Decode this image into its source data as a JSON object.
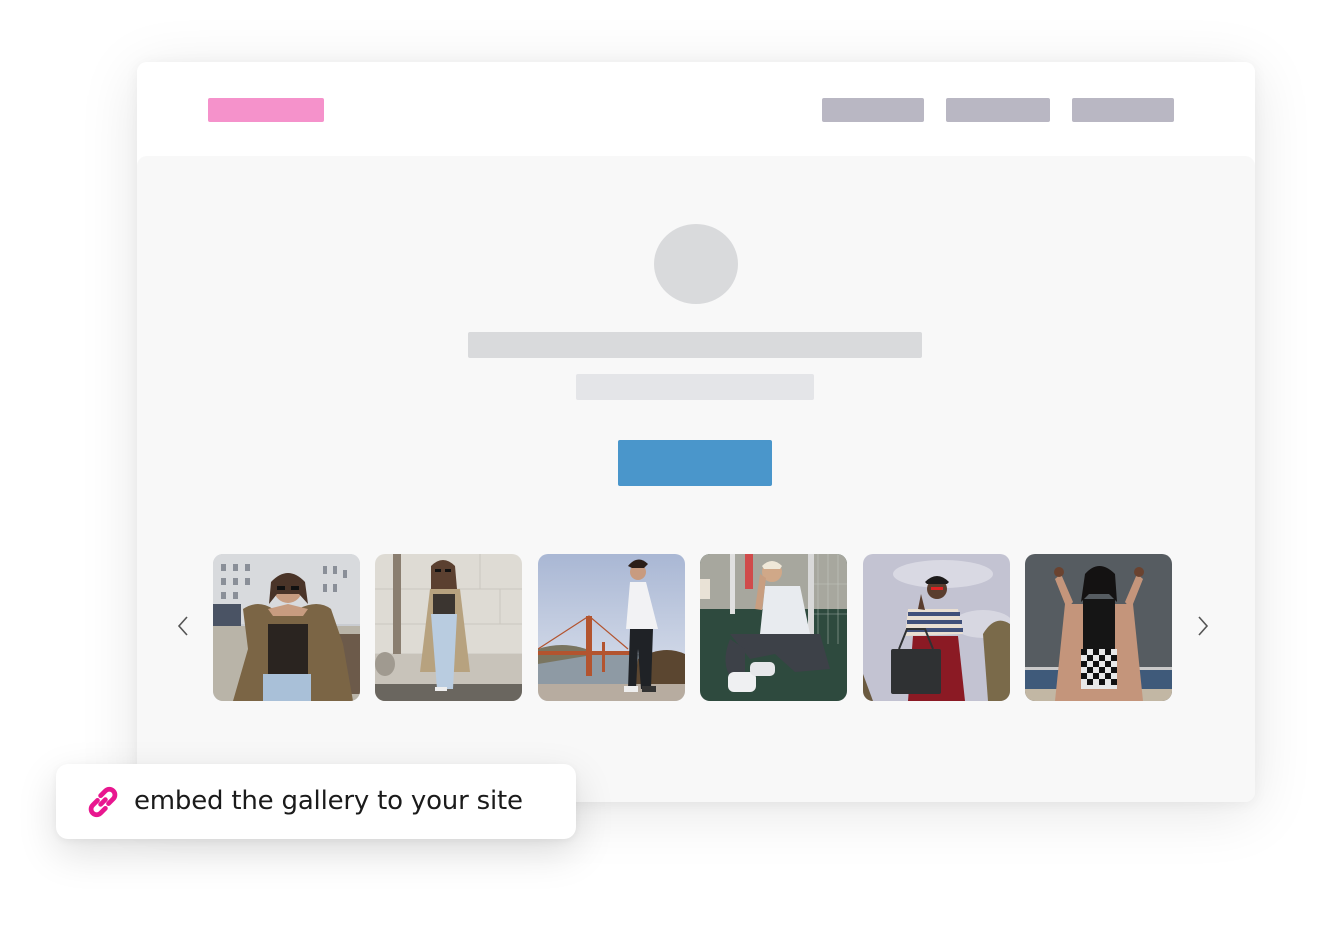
{
  "window": {
    "topbar": {
      "logo_color": "#f592cb",
      "nav_items": [
        {
          "color": "#b9b7c3"
        },
        {
          "color": "#b9b7c3"
        },
        {
          "color": "#b9b7c3"
        }
      ]
    },
    "profile": {
      "avatar_color": "#d9dadc",
      "title_color": "#d9dadc",
      "subtitle_color": "#e4e5e8",
      "cta_color": "#4a96cb"
    },
    "gallery": {
      "prev_icon": "chevron-left-icon",
      "next_icon": "chevron-right-icon",
      "items": [
        {
          "description": "Woman in sunglasses and brown trench coat posing with hands under chin, city street"
        },
        {
          "description": "Woman in beige trench coat and light jeans leaning against a stone wall"
        },
        {
          "description": "Man in white jacket standing with Golden Gate Bridge in background"
        },
        {
          "description": "Woman in white t-shirt sitting on green turf court"
        },
        {
          "description": "Woman in striped top and red skirt holding black handbag against cloudy sky"
        },
        {
          "description": "Woman in tan coat and checkered skirt posing against dark wall"
        }
      ]
    }
  },
  "embed_badge": {
    "icon": "link-icon",
    "icon_color": "#e8178f",
    "label": "embed the gallery to your site"
  }
}
